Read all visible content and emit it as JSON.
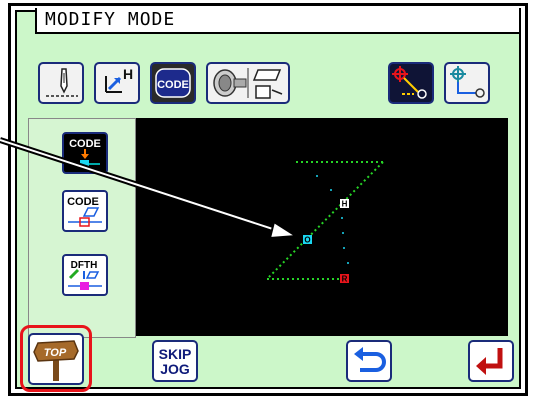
{
  "mode_title": "MODIFY MODE",
  "toolbar": {
    "code_label": "CODE",
    "jog_label": "H"
  },
  "sidebar": {
    "items": [
      {
        "label": "CODE"
      },
      {
        "label": "CODE"
      },
      {
        "label": "DFTH"
      }
    ]
  },
  "pattern": {
    "marker_h": "H",
    "marker_o": "O",
    "marker_r": "R"
  },
  "bottom": {
    "top_label": "TOP",
    "skip_label": "SKIP",
    "jog_label": "JOG"
  },
  "colors": {
    "accent": "#e8141b",
    "stitch": "#27d427",
    "button_border": "#1a2b7a"
  }
}
